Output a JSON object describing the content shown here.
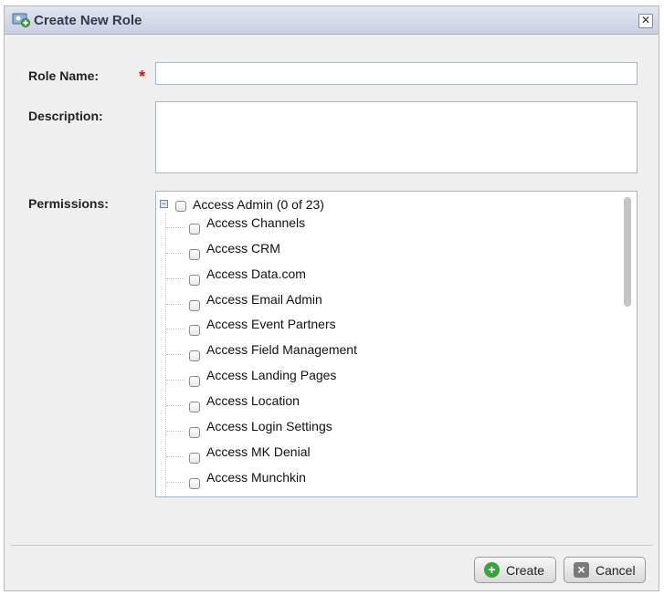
{
  "dialog": {
    "title": "Create New Role",
    "close_symbol": "✕"
  },
  "form": {
    "role_name_label": "Role Name:",
    "required_marker": "*",
    "role_name_value": "",
    "description_label": "Description:",
    "description_value": "",
    "permissions_label": "Permissions:"
  },
  "permissions": {
    "root_label": "Access Admin (0 of 23)",
    "expanded": true,
    "items": [
      {
        "label": "Access Channels",
        "checked": false
      },
      {
        "label": "Access CRM",
        "checked": false
      },
      {
        "label": "Access Data.com",
        "checked": false
      },
      {
        "label": "Access Email Admin",
        "checked": false
      },
      {
        "label": "Access Event Partners",
        "checked": false
      },
      {
        "label": "Access Field Management",
        "checked": false
      },
      {
        "label": "Access Landing Pages",
        "checked": false
      },
      {
        "label": "Access Location",
        "checked": false
      },
      {
        "label": "Access Login Settings",
        "checked": false
      },
      {
        "label": "Access MK Denial",
        "checked": false
      },
      {
        "label": "Access Munchkin",
        "checked": false
      }
    ]
  },
  "buttons": {
    "create_label": "Create",
    "cancel_label": "Cancel"
  },
  "colors": {
    "required": "#d4141a",
    "create_icon": "#3aa53f",
    "cancel_icon": "#7a7a7a"
  }
}
